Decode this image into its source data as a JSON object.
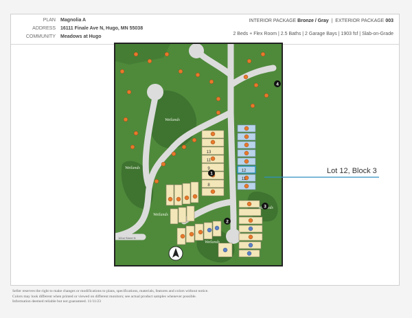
{
  "header": {
    "plan_label": "PLAN",
    "plan_value": "Magnolia A",
    "address_label": "ADDRESS",
    "address_value": "16111 Finale Ave N, Hugo, MN 55038",
    "community_label": "COMMUNITY",
    "community_value": "Meadows at Hugo",
    "interior_label": "INTERIOR PACKAGE",
    "interior_value": "Bronze / Gray",
    "exterior_label": "EXTERIOR PACKAGE",
    "exterior_value": "003",
    "separator": "|",
    "specs": "2 Beds + Flex Room  |  2.5 Baths  |  2 Garage Bays  |  1903  fsf  |  Slab-on-Grade"
  },
  "map": {
    "wetlands_labels": [
      "Wetlands",
      "Wetlands",
      "Wetlands",
      "Wetlands",
      "Wetlands"
    ],
    "street_label": "161st Street N",
    "block_markers": [
      "1",
      "2",
      "3",
      "4"
    ],
    "lot_numbers": [
      "13",
      "11",
      "9",
      "8",
      "12",
      "11"
    ],
    "colors": {
      "grass": "#4f8a3b",
      "dark_grass": "#3e7330",
      "road": "#dcdcdc",
      "lot_tan": "#f3e6b8",
      "lot_blue": "#b9d4ea",
      "home_orange": "#e8782b",
      "home_blue": "#5b7fc6",
      "highlight": "#2a8fc0"
    }
  },
  "callout": {
    "text": "Lot 12, Block 3"
  },
  "disclaimer": {
    "line1": "Seller reserves the right to make changes or modifications to plans, specifications, materials, features and colors without notice.",
    "line2": "Colors may look different when printed or viewed on different monitors; see actual product samples whenever possible.",
    "line3": "Information deemed reliable but not guaranteed. 11/11/23"
  }
}
